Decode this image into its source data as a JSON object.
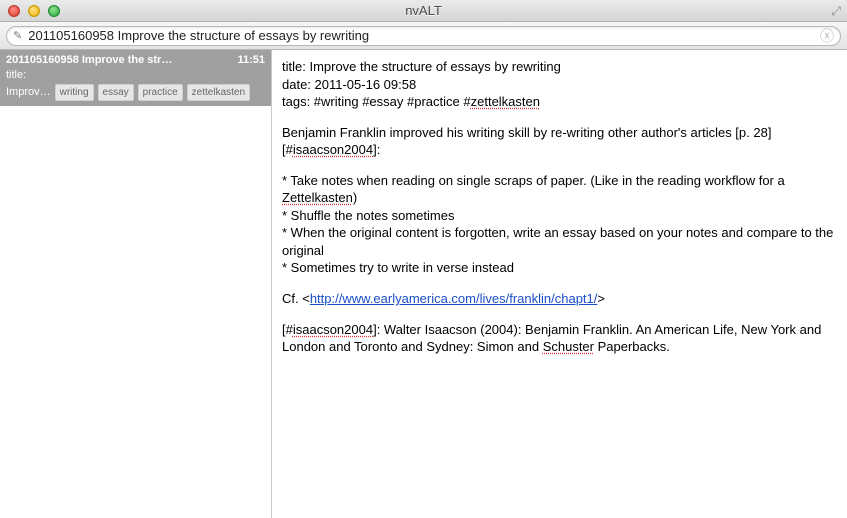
{
  "window": {
    "title": "nvALT"
  },
  "search": {
    "value": "201105160958 Improve the structure of essays by rewriting"
  },
  "sidebar": {
    "selected": {
      "title": "201105160958 Improve the str…",
      "time": "11:51",
      "subtitle_label": "title:",
      "preview": "Improv…",
      "tags": [
        "writing",
        "essay",
        "practice",
        "zettelkasten"
      ]
    }
  },
  "note": {
    "line_title": "title: Improve the structure of essays by rewriting",
    "line_date": "date: 2011-05-16 09:58",
    "tags_prefix": "tags: #writing #essay #practice #",
    "tags_spell": "zettelkasten",
    "body1_a": "Benjamin Franklin improved his writing skill by re-writing other author's articles [p. 28][#",
    "body1_spell": "isaacson2004",
    "body1_b": "]:",
    "bullet1_a": "* Take notes when reading on single scraps of paper. (Like in the reading workflow for a ",
    "bullet1_spell": "Zettelkasten",
    "bullet1_b": ")",
    "bullet2": "* Shuffle the notes sometimes",
    "bullet3": "* When the original content is forgotten, write an essay based on your notes and compare to the original",
    "bullet4": "* Sometimes try to write in verse instead",
    "cf_prefix": "Cf. <",
    "cf_link": "http://www.earlyamerica.com/lives/franklin/chapt1/",
    "cf_suffix": ">",
    "ref_a": "[#",
    "ref_spell1": "isaacson2004",
    "ref_b": "]: Walter Isaacson (2004):  Benjamin Franklin. An American Life, New York and London and Toronto and Sydney: Simon and ",
    "ref_spell2": "Schuster",
    "ref_c": " Paperbacks."
  }
}
